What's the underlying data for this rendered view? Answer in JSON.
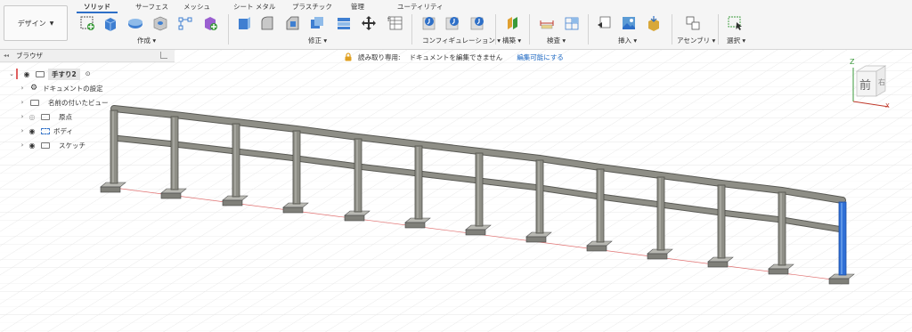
{
  "workspace": {
    "label": "デザイン"
  },
  "tabs": [
    {
      "label": "ソリッド"
    },
    {
      "label": "サーフェス"
    },
    {
      "label": "メッシュ"
    },
    {
      "label": "シート メタル"
    },
    {
      "label": "プラスチック"
    },
    {
      "label": "管理"
    },
    {
      "label": "ユーティリティ"
    }
  ],
  "groups": {
    "create": "作成",
    "modify": "修正",
    "configure": "コンフィギュレーション",
    "construct": "構築",
    "inspect": "検査",
    "insert": "挿入",
    "assemble": "アセンブリ",
    "select": "選択"
  },
  "browser": {
    "title": "ブラウザ",
    "root": "手すり2",
    "items": [
      {
        "label": "ドキュメントの設定",
        "icon": "gear-icon"
      },
      {
        "label": "名前の付いたビュー",
        "icon": "folder-icon"
      },
      {
        "label": "原点",
        "icon": "folder-icon"
      },
      {
        "label": "ボディ",
        "icon": "folder-icon"
      },
      {
        "label": "スケッチ",
        "icon": "folder-icon"
      }
    ]
  },
  "banner": {
    "mode": "読み取り専用:",
    "message": "ドキュメントを編集できません",
    "link": "編集可能にする"
  },
  "viewcube": {
    "face": "前",
    "side": "右",
    "axis_z": "Z",
    "axis_x": "X"
  },
  "colors": {
    "accent": "#2e6fc7",
    "selected_post": "#2f6fd6",
    "rail": "#8e8e86",
    "grid": "#e6e6e6"
  }
}
